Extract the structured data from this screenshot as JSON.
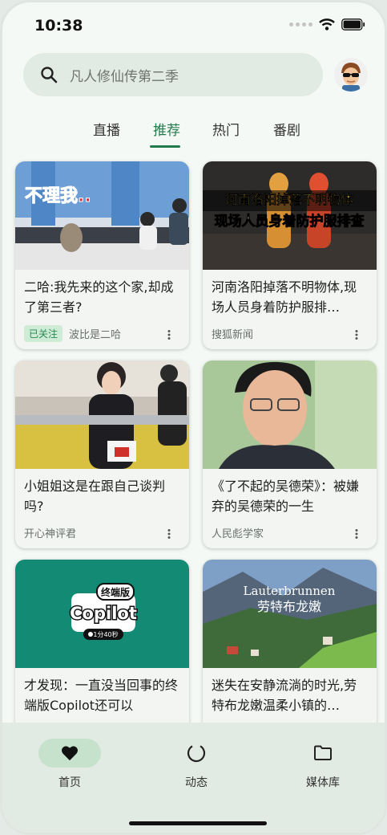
{
  "status": {
    "time": "10:38"
  },
  "search": {
    "placeholder": "凡人修仙传第二季"
  },
  "tabs": [
    {
      "label": "直播"
    },
    {
      "label": "推荐",
      "active": true
    },
    {
      "label": "热门"
    },
    {
      "label": "番剧"
    }
  ],
  "cards": [
    {
      "title": "二哈:我先来的这个家,却成了第三者?",
      "badge": "已关注",
      "author": "波比是二哈",
      "thumb_text": "不理我.."
    },
    {
      "title": "河南洛阳掉落不明物体,现场人员身着防护服排…",
      "author": "搜狐新闻",
      "thumb_text": [
        "河南洛阳掉落不明物体",
        "现场人员身着防护服排查"
      ]
    },
    {
      "title": "小姐姐这是在跟自己谈判吗?",
      "author": "开心神评君"
    },
    {
      "title": "《了不起的吴德荣》：被嫌弃的吴德荣的一生",
      "author": "人民彪学家"
    },
    {
      "title": "才发现：一直没当回事的终端版Copilot还可以",
      "thumb_text": [
        "终端版",
        "Copilot",
        "1分40秒"
      ]
    },
    {
      "title": "迷失在安静流淌的时光,劳特布龙嫩温柔小镇的…",
      "thumb_text": [
        "Lauterbrunnen",
        "劳特布龙嫩"
      ]
    }
  ],
  "nav": [
    {
      "label": "首页",
      "icon": "heart-icon",
      "active": true
    },
    {
      "label": "动态",
      "icon": "circle-refresh-icon"
    },
    {
      "label": "媒体库",
      "icon": "folder-icon"
    }
  ],
  "colors": {
    "accent": "#237a4d",
    "background": "#f5f9f5",
    "nav_bg": "#e2ebe3",
    "pill": "#c6e2cd"
  }
}
